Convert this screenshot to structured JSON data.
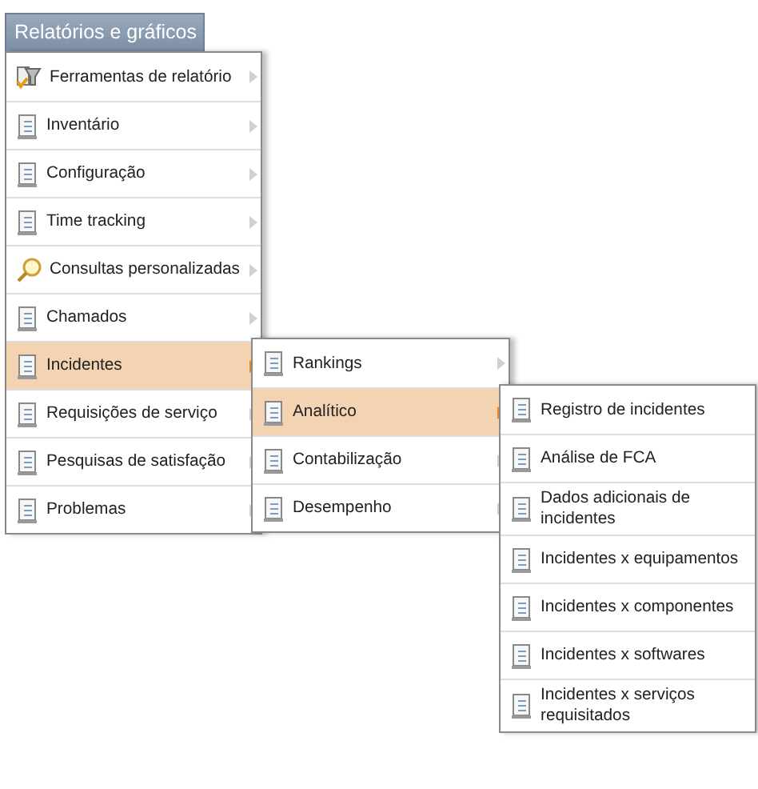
{
  "menu_button": {
    "label": "Relatórios e gráficos"
  },
  "menus": [
    {
      "items": [
        {
          "label": "Ferramentas de relatório",
          "kind": "tools",
          "has_submenu": true,
          "selected": false
        },
        {
          "label": "Inventário",
          "kind": "report",
          "has_submenu": true,
          "selected": false
        },
        {
          "label": "Configuração",
          "kind": "report",
          "has_submenu": true,
          "selected": false
        },
        {
          "label": "Time tracking",
          "kind": "report",
          "has_submenu": true,
          "selected": false
        },
        {
          "label": "Consultas personalizadas",
          "kind": "search",
          "has_submenu": true,
          "selected": false
        },
        {
          "label": "Chamados",
          "kind": "report",
          "has_submenu": true,
          "selected": false
        },
        {
          "label": "Incidentes",
          "kind": "report",
          "has_submenu": true,
          "selected": true
        },
        {
          "label": "Requisições de serviço",
          "kind": "report",
          "has_submenu": true,
          "selected": false
        },
        {
          "label": "Pesquisas de satisfação",
          "kind": "report",
          "has_submenu": true,
          "selected": false
        },
        {
          "label": "Problemas",
          "kind": "report",
          "has_submenu": true,
          "selected": false
        }
      ]
    },
    {
      "items": [
        {
          "label": "Rankings",
          "kind": "report",
          "has_submenu": true,
          "selected": false
        },
        {
          "label": "Analítico",
          "kind": "report",
          "has_submenu": true,
          "selected": true
        },
        {
          "label": "Contabilização",
          "kind": "report",
          "has_submenu": true,
          "selected": false
        },
        {
          "label": "Desempenho",
          "kind": "report",
          "has_submenu": true,
          "selected": false
        }
      ]
    },
    {
      "items": [
        {
          "label": "Registro de incidentes",
          "kind": "report",
          "has_submenu": false,
          "selected": false
        },
        {
          "label": "Análise de FCA",
          "kind": "report",
          "has_submenu": false,
          "selected": false
        },
        {
          "label": "Dados adicionais de incidentes",
          "kind": "report",
          "has_submenu": false,
          "selected": false
        },
        {
          "label": "Incidentes x equipamentos",
          "kind": "report",
          "has_submenu": false,
          "selected": false
        },
        {
          "label": "Incidentes x componentes",
          "kind": "report",
          "has_submenu": false,
          "selected": false
        },
        {
          "label": "Incidentes x softwares",
          "kind": "report",
          "has_submenu": false,
          "selected": false
        },
        {
          "label": "Incidentes x serviços requisitados",
          "kind": "report",
          "has_submenu": false,
          "selected": false
        }
      ]
    }
  ]
}
